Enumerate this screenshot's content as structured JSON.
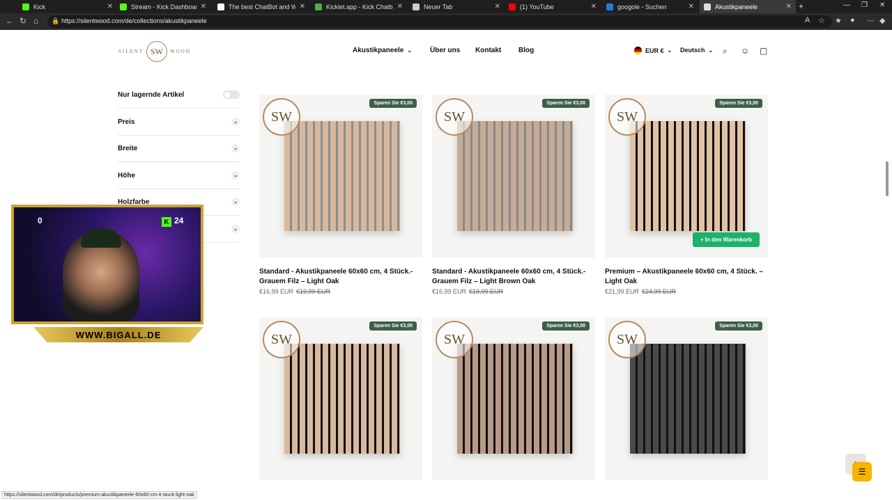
{
  "browser": {
    "tabs": [
      {
        "title": "Kick",
        "color": "#53fc18",
        "active": false
      },
      {
        "title": "Stream - Kick Dashboard",
        "color": "#53fc18",
        "active": false
      },
      {
        "title": "The best ChatBot and Widgets fo",
        "color": "#ffffff",
        "active": false
      },
      {
        "title": "Kicklet.app - Kick Chatbot and Ov",
        "color": "#4caf50",
        "active": false
      },
      {
        "title": "Neuer Tab",
        "color": "#cccccc",
        "active": false
      },
      {
        "title": "(1) YouTube",
        "color": "#ff0000",
        "active": false
      },
      {
        "title": "googole - Suchen",
        "color": "#2b7bd9",
        "active": false
      },
      {
        "title": "Akustikpaneele",
        "color": "#dddddd",
        "active": true
      }
    ],
    "url": "https://silentwood.com/de/collections/akustikpaneele",
    "status_url": "https://silentwood.com/de/products/premium-akustikpaneele-60x60-cm-4-stuck-light-oak"
  },
  "header": {
    "logo": {
      "left": "SILENT",
      "mark": "SW",
      "right": "WOOD"
    },
    "nav": [
      {
        "label": "Akustikpaneele",
        "has_dropdown": true
      },
      {
        "label": "Über uns",
        "has_dropdown": false
      },
      {
        "label": "Kontakt",
        "has_dropdown": false
      },
      {
        "label": "Blog",
        "has_dropdown": false
      }
    ],
    "currency": "EUR €",
    "language": "Deutsch"
  },
  "filters": [
    {
      "label": "Nur lagernde Artikel",
      "type": "toggle"
    },
    {
      "label": "Preis",
      "type": "accordion"
    },
    {
      "label": "Breite",
      "type": "accordion"
    },
    {
      "label": "Höhe",
      "type": "accordion"
    },
    {
      "label": "Holzfarbe",
      "type": "accordion"
    }
  ],
  "products": [
    {
      "title": "Standard - Akustikpaneele 60x60 cm, 4 Stück.- Grauem Filz – Light Oak",
      "price": "€16,99 EUR",
      "old_price": "€19,99 EUR",
      "badge": "Sparen Sie €3,00",
      "wood": "#d8b89a",
      "felt": "#8a8e93"
    },
    {
      "title": "Standard - Akustikpaneele 60x60 cm, 4 Stück.- Grauem Filz – Light Brown Oak",
      "price": "€16,99 EUR",
      "old_price": "€19,99 EUR",
      "badge": "Sparen Sie €3,00",
      "wood": "#c9ab93",
      "felt": "#858a90"
    },
    {
      "title": "Premium – Akustikpaneele 60x60 cm, 4 Stück. – Light Oak",
      "price": "€21,99 EUR",
      "old_price": "€24,99 EUR",
      "badge": "Sparen Sie €3,00",
      "wood": "#e2c2a5",
      "felt": "#111111",
      "cart_button": "+ In den Warenkorb"
    },
    {
      "title": "",
      "price": "",
      "old_price": "",
      "badge": "Sparen Sie €3,00",
      "wood": "#d9b8a0",
      "felt": "#111111"
    },
    {
      "title": "",
      "price": "",
      "old_price": "",
      "badge": "Sparen Sie €3,00",
      "wood": "#b89a88",
      "felt": "#111111"
    },
    {
      "title": "",
      "price": "",
      "old_price": "",
      "badge": "Sparen Sie €3,00",
      "wood": "#4a4a4a",
      "felt": "#111111"
    }
  ],
  "overlay": {
    "left_counter": "0",
    "right_counter": "24",
    "banner": "WWW.BIGALL.DE"
  },
  "colors": {
    "badge": "#3e5e48",
    "cart_button": "#1db26b",
    "logo_gold": "#a8835a"
  }
}
